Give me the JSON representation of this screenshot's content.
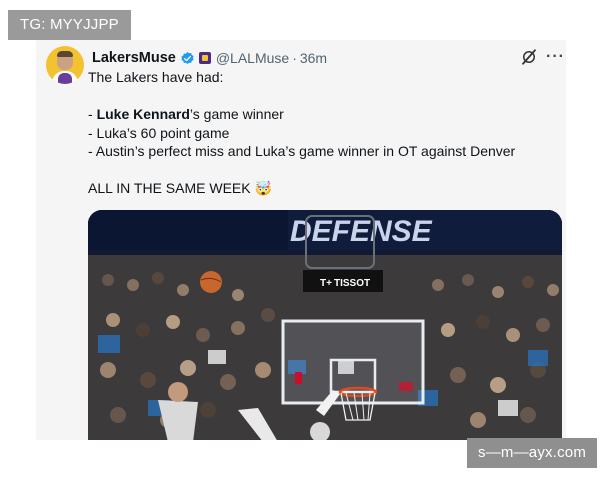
{
  "watermark_top": "TG: MYYJJPP",
  "watermark_bottom": "s—m—ayx.com",
  "tweet": {
    "display_name": "LakersMuse",
    "handle": "@LALMuse",
    "separator": "·",
    "time": "36m",
    "lines": {
      "l1": "The Lakers have had:",
      "l2_prefix": "- ",
      "l2_bold": "Luke Kennard",
      "l2_suffix": "’s game winner",
      "l3": "- Luka’s 60 point game",
      "l4": "- Austin’s perfect miss and Luka’s game winner in OT against Denver",
      "l5": "ALL IN THE SAME WEEK 🤯"
    }
  },
  "media": {
    "banner_text": "DEFENSE",
    "sponsor_text": "TISSOT",
    "sponsor_mark": "T+"
  },
  "colors": {
    "verified": "#1d9bf0",
    "badge": "#4b2a86",
    "gold": "#f2c230"
  }
}
